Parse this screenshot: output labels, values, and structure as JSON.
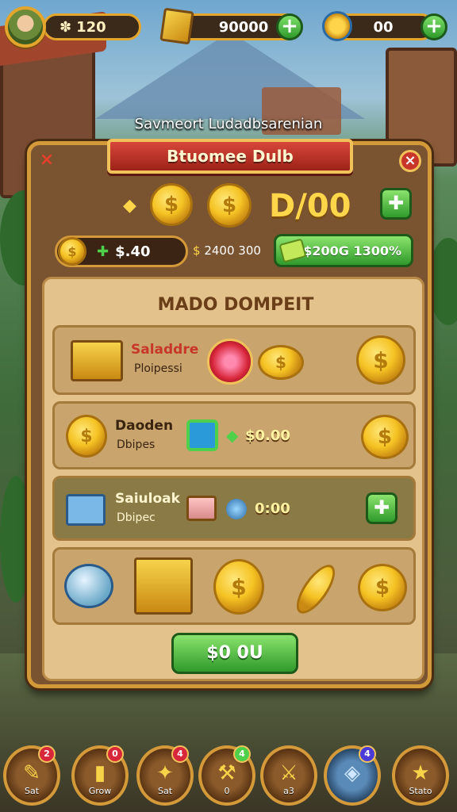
{
  "hud": {
    "left_value": "120",
    "left_prefix": "✽",
    "mid_value": "90000",
    "right_value": "00",
    "plus_symbol": "+"
  },
  "scene_title": "Savmeort Ludadbsarenian",
  "panel": {
    "ribbon_title": "Btuomee Dulb",
    "close_symbol": "×",
    "coin_symbol": "$",
    "big_amount": "D/00",
    "top_green_symbol": "✚",
    "balance_value": "$.40",
    "small_amount": "2400 300",
    "green_bar_label": "$200G 1300%",
    "section_title": "MADO DOMPEIT",
    "rows": [
      {
        "name": "Saladdre",
        "sub": "Ploipessi"
      },
      {
        "name": "Daoden",
        "sub": "Dbipes",
        "price": "$0.00"
      },
      {
        "name": "Saiuloak",
        "sub": "Dbipec",
        "price": "0:00",
        "button_symbol": "✚"
      }
    ],
    "buy_button": "$0 0U"
  },
  "nav": {
    "items": [
      {
        "label": "Sat",
        "badge": "2"
      },
      {
        "label": "Grow",
        "badge": "0"
      },
      {
        "label": "Sat",
        "badge": "4"
      },
      {
        "label": "0",
        "badge": "4"
      },
      {
        "label": "a3",
        "badge": ""
      },
      {
        "label": "",
        "badge": "4"
      },
      {
        "label": "Stato",
        "badge": ""
      }
    ]
  },
  "colors": {
    "accent_gold": "#d49a3a",
    "green_button": "#2f9a2b",
    "ribbon_red": "#c8362a"
  }
}
